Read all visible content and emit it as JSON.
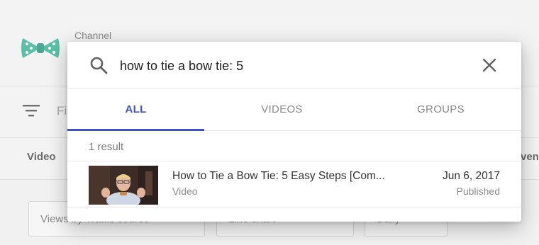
{
  "background": {
    "channel_label": "Channel",
    "filter_placeholder": "Fi",
    "column_video": "Video",
    "column_right": "ven",
    "controls": [
      "Views by Traffic source",
      "Line chart",
      "Daily"
    ]
  },
  "search": {
    "query": "how to tie a bow tie: 5",
    "icon": "search-icon",
    "close_icon": "close-icon"
  },
  "tabs": [
    {
      "label": "ALL",
      "active": true
    },
    {
      "label": "VIDEOS",
      "active": false
    },
    {
      "label": "GROUPS",
      "active": false
    }
  ],
  "results": {
    "count_text": "1 result",
    "items": [
      {
        "title": "How to Tie a Bow Tie: 5 Easy Steps [Com...",
        "type": "Video",
        "date": "Jun 6, 2017",
        "status": "Published"
      }
    ]
  },
  "colors": {
    "accent": "#3f51c6",
    "bow_tie": "#5bbfa8"
  }
}
